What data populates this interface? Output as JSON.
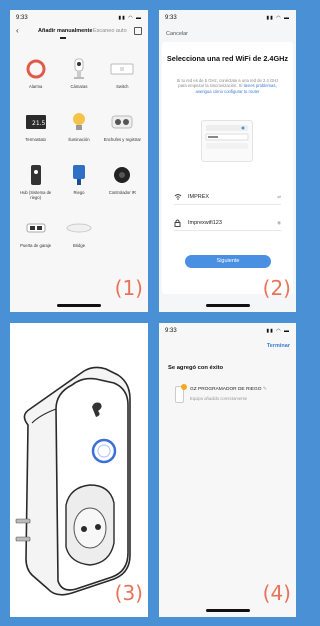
{
  "panels": {
    "p1": {
      "time": "9:33",
      "tab_active": "Añadir manualmente",
      "tab_other": "Escaneo auto",
      "categories": [
        {
          "label": "Alarma",
          "icon": "alarm-icon"
        },
        {
          "label": "Cámaras",
          "icon": "camera-icon"
        },
        {
          "label": "Switch",
          "icon": "switch-icon"
        },
        {
          "label": "Termostato",
          "icon": "thermostat-icon"
        },
        {
          "label": "Iluminación",
          "icon": "bulb-icon"
        },
        {
          "label": "Enchufes y registrar",
          "icon": "plug-icon"
        },
        {
          "label": "Hub (Sistema de riego)",
          "icon": "hub-icon"
        },
        {
          "label": "Riego",
          "icon": "irrigation-icon"
        },
        {
          "label": "Controlador IR",
          "icon": "ir-controller-icon"
        },
        {
          "label": "Puerta de garaje",
          "icon": "garage-icon"
        },
        {
          "label": "Bridge",
          "icon": "bridge-icon"
        }
      ],
      "number": "(1)"
    },
    "p2": {
      "time": "9:33",
      "cancel": "Cancelar",
      "title": "Selecciona una red WiFi de 2.4GHz",
      "subtitle": "Si tu red es de 5 GHz, conéctate a una red de 2.4 GHz para empezar la sincronización. Si",
      "subtitle_link": "tienes problemas, averigua cómo configurar tu router",
      "wifi_name": "IMPREX",
      "password": "Imprexwifi123",
      "button": "Siguiente",
      "number": "(2)"
    },
    "p3": {
      "number": "(3)"
    },
    "p4": {
      "time": "9:33",
      "done": "Terminar",
      "title": "Se agregó con éxito",
      "device_name": "GZ PROGRAMADOR DE RIEGO",
      "device_status": "Equipo añadido correctamente",
      "number": "(4)"
    }
  },
  "colors": {
    "background": "#4a90d4",
    "accent": "#4a90e2",
    "number": "#e8735a"
  }
}
